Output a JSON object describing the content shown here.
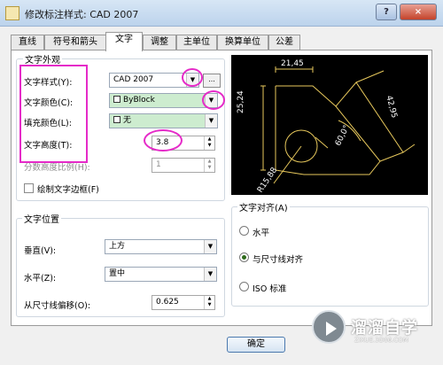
{
  "window": {
    "title": "修改标注样式: CAD 2007",
    "help_label": "?",
    "close_label": "×"
  },
  "tabs": [
    "直线",
    "符号和箭头",
    "文字",
    "调整",
    "主单位",
    "换算单位",
    "公差"
  ],
  "text_appearance": {
    "title": "文字外观",
    "style_label": "文字样式(Y):",
    "style_value": "CAD 2007",
    "style_button": "...",
    "color_label": "文字颜色(C):",
    "color_value": "ByBlock",
    "fill_label": "填充颜色(L):",
    "fill_value": "无",
    "height_label": "文字高度(T):",
    "height_value": "3.8",
    "fraction_label": "分数高度比例(H):",
    "fraction_value": "1",
    "frame_label": "绘制文字边框(F)"
  },
  "text_placement": {
    "title": "文字位置",
    "vertical_label": "垂直(V):",
    "vertical_value": "上方",
    "horizontal_label": "水平(Z):",
    "horizontal_value": "置中",
    "offset_label": "从尺寸线偏移(O):",
    "offset_value": "0.625"
  },
  "text_alignment": {
    "title": "文字对齐(A)",
    "options": [
      "水平",
      "与尺寸线对齐",
      "ISO 标准"
    ],
    "selected": "与尺寸线对齐"
  },
  "preview": {
    "top_dim": "21,45",
    "left_dim": "25,24",
    "right_dim": "42,95",
    "angle_dim": "60,0°",
    "radius_dim": "R15,88"
  },
  "buttons": {
    "ok": "确定"
  },
  "watermark": {
    "title": "溜溜自学",
    "url": "ZIXUE.3D66.COM"
  },
  "colors": {
    "annotation": "#e52ac8",
    "preview_line": "#e7c85c",
    "preview_text": "#ffffff"
  }
}
